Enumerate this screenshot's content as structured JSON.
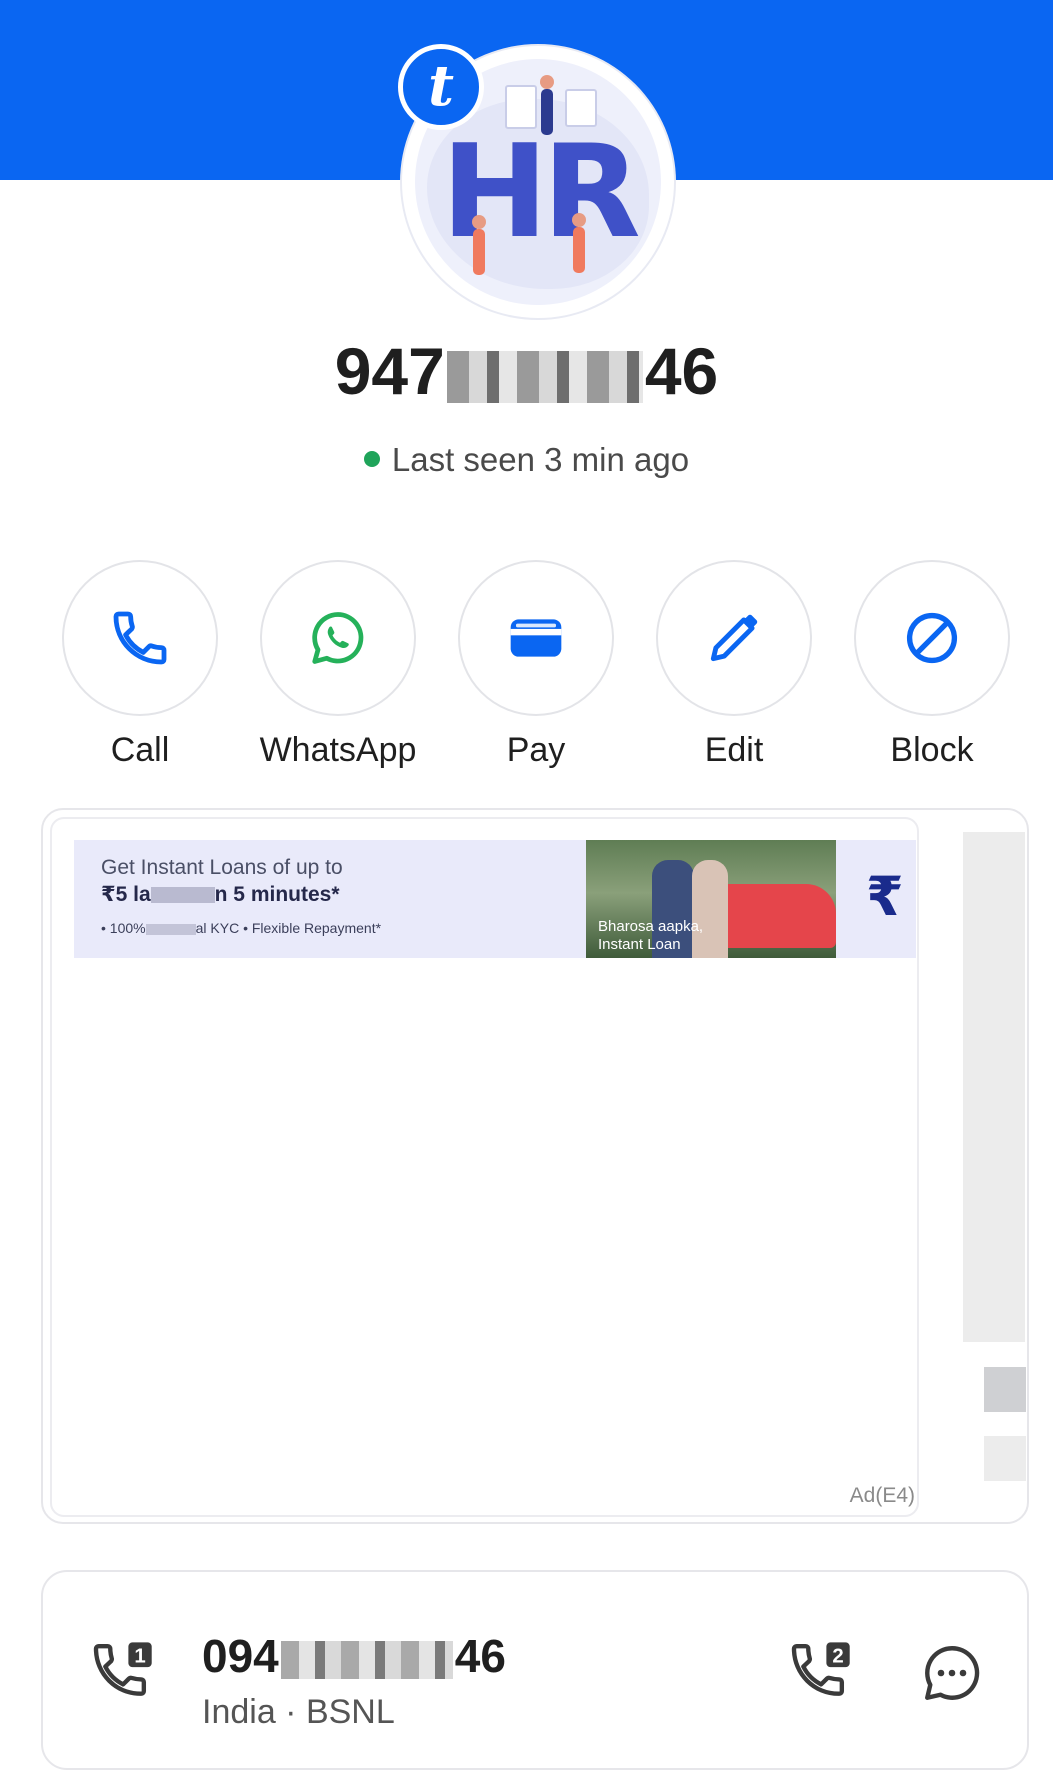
{
  "header": {
    "brand_color": "#0a66f2"
  },
  "profile": {
    "badge_letter": "t",
    "avatar_text": "HR",
    "number_prefix": "947",
    "number_suffix": "46",
    "status_text": "Last seen 3 min ago",
    "status_color": "#1fa45a"
  },
  "actions": [
    {
      "label": "Call",
      "icon": "phone-icon"
    },
    {
      "label": "WhatsApp",
      "icon": "whatsapp-icon"
    },
    {
      "label": "Pay",
      "icon": "wallet-icon"
    },
    {
      "label": "Edit",
      "icon": "pencil-icon"
    },
    {
      "label": "Block",
      "icon": "block-icon"
    }
  ],
  "ad": {
    "line1": "Get Instant Loans of up to",
    "line2_pre": "₹5 la",
    "line2_post": "n 5 minutes*",
    "line3_pre": "• 100%",
    "line3_post": "al KYC • Flexible Repayment*",
    "photo_caption_1": "Bharosa aapka,",
    "photo_caption_2": "Instant Loan",
    "tag": "Ad(E4)"
  },
  "number_card": {
    "number_prefix": "094",
    "number_suffix": "46",
    "subtitle": "India · BSNL",
    "sim1_label": "1",
    "sim2_label": "2"
  }
}
